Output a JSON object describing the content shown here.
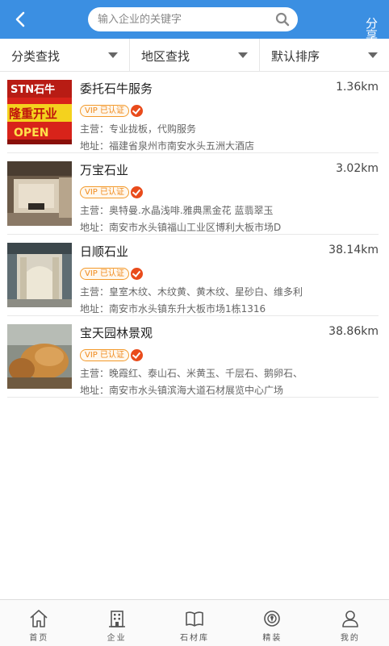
{
  "header": {
    "search_placeholder": "输入企业的关键字",
    "share_label": "分享"
  },
  "filters": [
    {
      "label": "分类查找"
    },
    {
      "label": "地区查找"
    },
    {
      "label": "默认排序"
    }
  ],
  "vip_label": "VIP 已认证",
  "items": [
    {
      "name": "委托石牛服务",
      "distance": "1.36km",
      "main": "主营：专业拢板，代购服务",
      "address": "地址：福建省泉州市南安水头五洲大酒店",
      "thumb_text": [
        "STN石牛",
        "隆重开业",
        "OPEN"
      ]
    },
    {
      "name": "万宝石业",
      "distance": "3.02km",
      "main": "主营：奥特曼.水晶浅啡.雅典黑金花 蓝翡翠玉",
      "address": "地址：南安市水头镇福山工业区博利大板市场D"
    },
    {
      "name": "日顺石业",
      "distance": "38.14km",
      "main": "主营：皇室木纹、木纹黄、黄木纹、星砂白、维多利",
      "address": "地址：南安市水头镇东升大板市场1栋1316"
    },
    {
      "name": "宝天园林景观",
      "distance": "38.86km",
      "main": "主营：晚霞红、泰山石、米黄玉、千层石、鹅卵石、",
      "address": "地址：南安市水头镇滨海大道石材展览中心广场"
    }
  ],
  "nav": [
    {
      "label": "首页",
      "icon": "home-icon"
    },
    {
      "label": "企业",
      "icon": "building-icon"
    },
    {
      "label": "石材库",
      "icon": "book-icon"
    },
    {
      "label": "精装",
      "icon": "refine-icon"
    },
    {
      "label": "我的",
      "icon": "user-icon"
    }
  ]
}
